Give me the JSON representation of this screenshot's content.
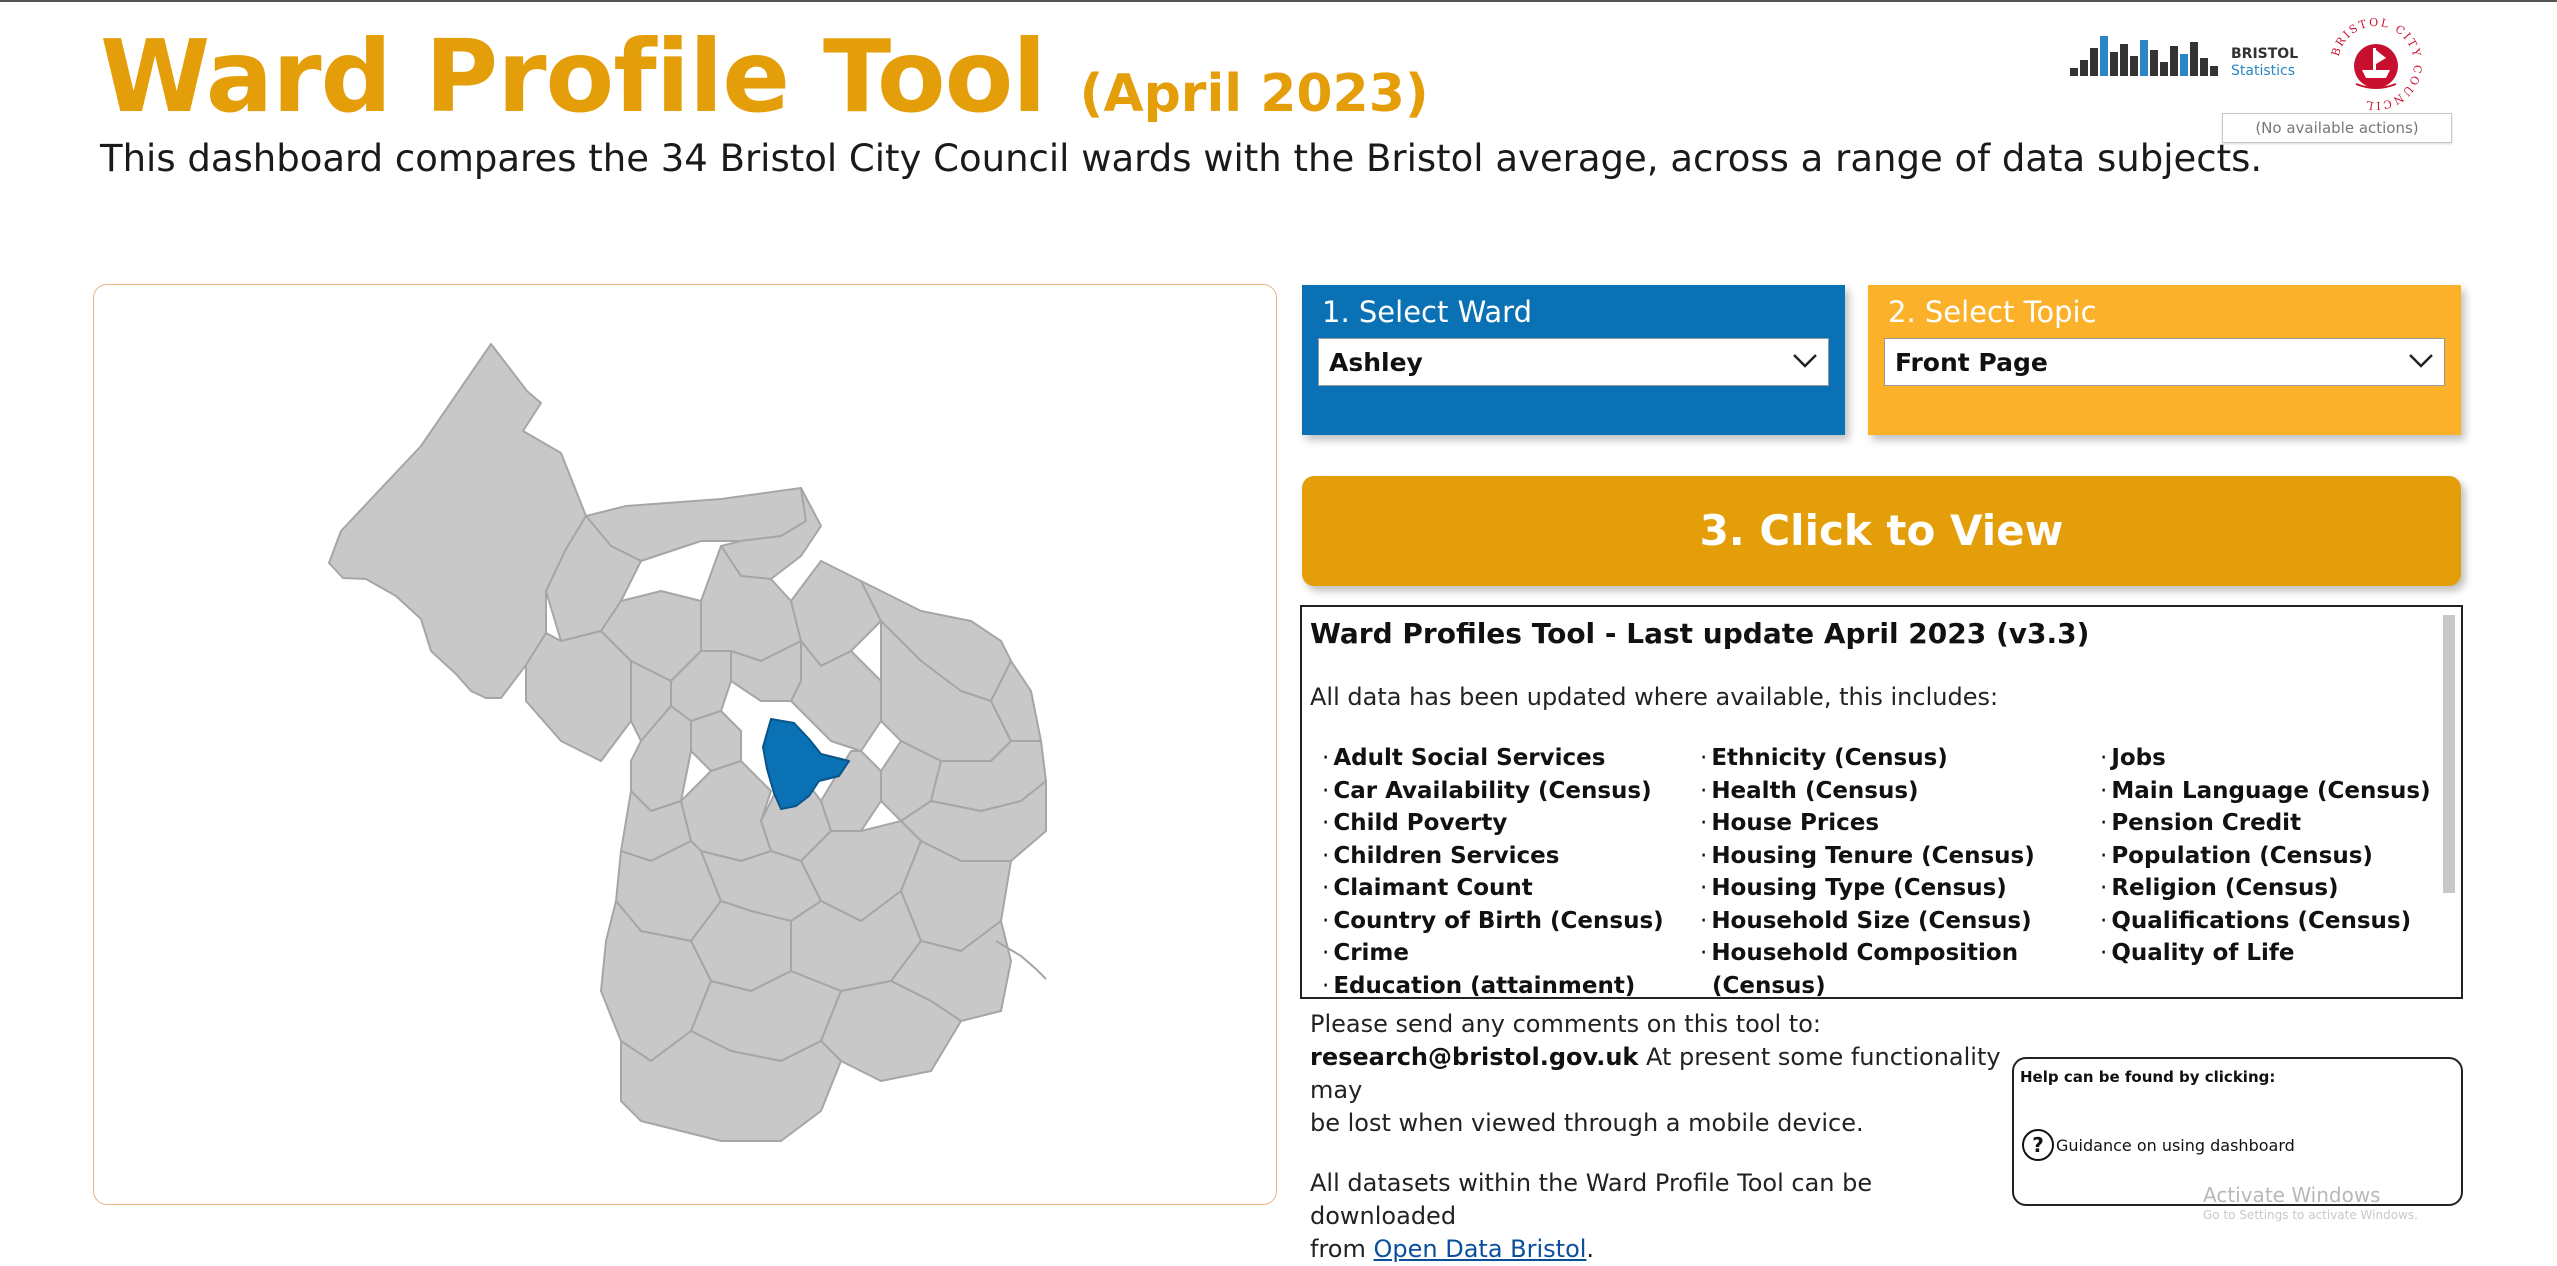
{
  "header": {
    "title": "Ward Profile Tool",
    "subtitle_date": "(April 2023)",
    "description": "This dashboard compares the 34 Bristol City Council wards with the Bristol average, across a range of data subjects."
  },
  "logos": {
    "stats_line1": "BRISTOL",
    "stats_line2": "Statistics",
    "council_text": "BRISTOL CITY COUNCIL"
  },
  "no_actions": "(No available actions)",
  "select_ward": {
    "label": "1. Select Ward",
    "value": "Ashley"
  },
  "select_topic": {
    "label": "2. Select Topic",
    "value": "Front Page"
  },
  "view_button": "3. Click to View",
  "info": {
    "title": "Ward Profiles Tool - Last update April 2023 (v3.3)",
    "intro": "All data has been updated where available, this includes:",
    "col1": [
      "Adult Social Services",
      "Car Availability (Census)",
      "Child Poverty",
      "Children Services",
      "Claimant Count",
      "Country of Birth (Census)",
      "Crime",
      "Education (attainment)"
    ],
    "col2": [
      "Ethnicity (Census)",
      "Health (Census)",
      "House Prices",
      "Housing Tenure (Census)",
      "Housing Type (Census)",
      "Household Size (Census)",
      "Household Composition",
      "(Census)"
    ],
    "col3": [
      "Jobs",
      "Main Language (Census)",
      "Pension Credit",
      "Population (Census)",
      "Religion (Census)",
      "Qualifications (Census)",
      "Quality of Life"
    ]
  },
  "comments": {
    "line1": "Please send any comments on this tool to:",
    "email": "research@bristol.gov.uk",
    "line2a": " At present some functionality may",
    "line2b": "be lost when viewed through a mobile device.",
    "line3": "All datasets within the Ward Profile Tool can be downloaded",
    "line4_prefix": "from ",
    "link": "Open Data Bristol",
    "line4_suffix": "."
  },
  "help": {
    "title": "Help can be found by clicking:",
    "link": "Guidance on using dashboard",
    "icon": "question-circle-icon"
  },
  "watermark": {
    "line1": "Activate Windows",
    "line2": "Go to Settings to activate Windows."
  },
  "colors": {
    "title_orange": "#e49e0a",
    "ward_blue": "#0a72b4",
    "topic_yellow": "#fbb12a",
    "view_button": "#e49e0a",
    "ward_fill": "#c8c8c8",
    "ward_selected": "#0a72b4"
  },
  "map": {
    "selected_ward": "Ashley"
  }
}
